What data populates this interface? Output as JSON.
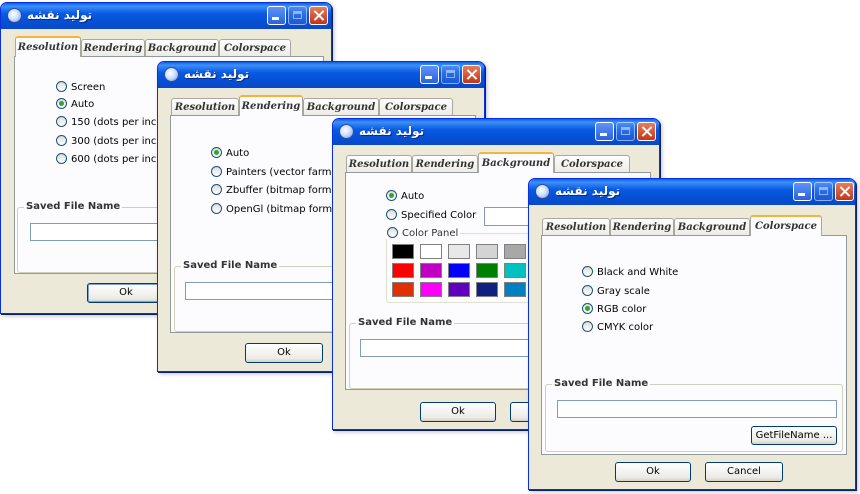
{
  "windows": [
    {
      "title": "تولید نقشه",
      "tabs": [
        "Resolution",
        "Rendering",
        "Background",
        "Colorspace"
      ],
      "active_tab": "Resolution",
      "options": [
        "Screen",
        "Auto",
        "150 (dots per inch)",
        "300 (dots per inch)",
        "600 (dots per inch)"
      ],
      "selected": "Auto",
      "saved_file_label": "Saved File Name",
      "saved_file_value": "",
      "ok_label": "Ok"
    },
    {
      "title": "تولید نقشه",
      "tabs": [
        "Resolution",
        "Rendering",
        "Background",
        "Colorspace"
      ],
      "active_tab": "Rendering",
      "options": [
        "Auto",
        "Painters (vector farmat)",
        "Zbuffer (bitmap format)",
        "OpenGl (bitmap format)"
      ],
      "selected": "Auto",
      "saved_file_label": "Saved File Name",
      "saved_file_value": "",
      "ok_label": "Ok"
    },
    {
      "title": "تولید نقشه",
      "tabs": [
        "Resolution",
        "Rendering",
        "Background",
        "Colorspace"
      ],
      "active_tab": "Background",
      "options": [
        "Auto",
        "Specified Color",
        "Color Panel"
      ],
      "selected": "Auto",
      "specified_color_value": "",
      "palette": [
        [
          "#000000",
          "#ffffff",
          "#e8e8e8",
          "#d4d4d4",
          "#a8a8a8"
        ],
        [
          "#ff0000",
          "#c000c0",
          "#0000ff",
          "#008000",
          "#00c0c0"
        ],
        [
          "#e03000",
          "#ff00ff",
          "#6000c0",
          "#102080",
          "#0080c0"
        ]
      ],
      "saved_file_label": "Saved File Name",
      "saved_file_value": "",
      "ok_label": "Ok"
    },
    {
      "title": "تولید نقشه",
      "tabs": [
        "Resolution",
        "Rendering",
        "Background",
        "Colorspace"
      ],
      "active_tab": "Colorspace",
      "options": [
        "Black and White",
        "Gray scale",
        "RGB color",
        "CMYK color"
      ],
      "selected": "RGB color",
      "saved_file_label": "Saved File Name",
      "saved_file_value": "",
      "getfilename_label": "GetFileName ...",
      "ok_label": "Ok",
      "cancel_label": "Cancel"
    }
  ],
  "colors": {
    "titlebar": "#0a5ae3",
    "dialog_bg": "#ece9d8",
    "active_tab_accent": "#f5b43a",
    "radio_dot": "#2fa62f"
  }
}
